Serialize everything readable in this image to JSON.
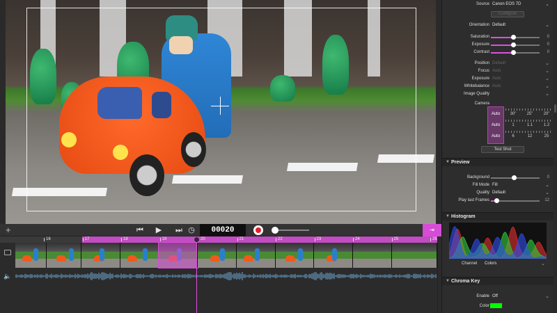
{
  "viewer": {
    "frame_counter": "00020"
  },
  "transport": {
    "add_icon": "plus-icon",
    "prev_icon": "step-back-icon",
    "play_icon": "play-icon",
    "next_icon": "step-forward-icon",
    "timer_icon": "clock-icon",
    "record_color": "#e0202a",
    "accent": "#d64cd6"
  },
  "timeline": {
    "ticks": [
      "16",
      "17",
      "18",
      "19",
      "20",
      "21",
      "22",
      "23",
      "24",
      "25",
      "26"
    ]
  },
  "panel": {
    "source_label": "Source",
    "source_value": "Canon EOS 7D",
    "configure_label": "Configure",
    "orientation_label": "Orientation",
    "orientation_value": "Default",
    "saturation_label": "Saturation",
    "saturation_num": "0",
    "exposure_label": "Exposure",
    "exposure_num": "0",
    "contrast_label": "Contrast",
    "contrast_num": "0",
    "position_label": "Position",
    "position_value": "Default",
    "focus_label": "Focus",
    "focus_value": "Auto",
    "exposure2_label": "Exposure",
    "exposure2_value": "Auto",
    "whitebalance_label": "Whitebalance",
    "whitebalance_value": "Auto",
    "image_quality_label": "Image Quality",
    "camera_label": "Camera",
    "camera_rows": [
      {
        "auto": "Auto",
        "values": [
          "30\"",
          "25\"",
          "20\""
        ]
      },
      {
        "auto": "Auto",
        "values": [
          "1",
          "1.1",
          "1.2"
        ]
      },
      {
        "auto": "Auto",
        "values": [
          "6",
          "12",
          "25"
        ]
      }
    ],
    "test_shot_label": "Test Shot",
    "preview_title": "Preview",
    "background_label": "Background",
    "background_num": "0",
    "fill_mode_label": "Fill Mode",
    "fill_mode_value": "Fill",
    "quality_label": "Quality",
    "quality_value": "Default",
    "play_last_label": "Play last Frames",
    "play_last_num": "12",
    "histogram_title": "Histogram",
    "channel_label": "Channel",
    "channel_value": "Colors",
    "chroma_title": "Chroma Key",
    "enable_label": "Enable",
    "enable_value": "Off",
    "color_label": "Color",
    "chroma_color": "#00ff00"
  }
}
